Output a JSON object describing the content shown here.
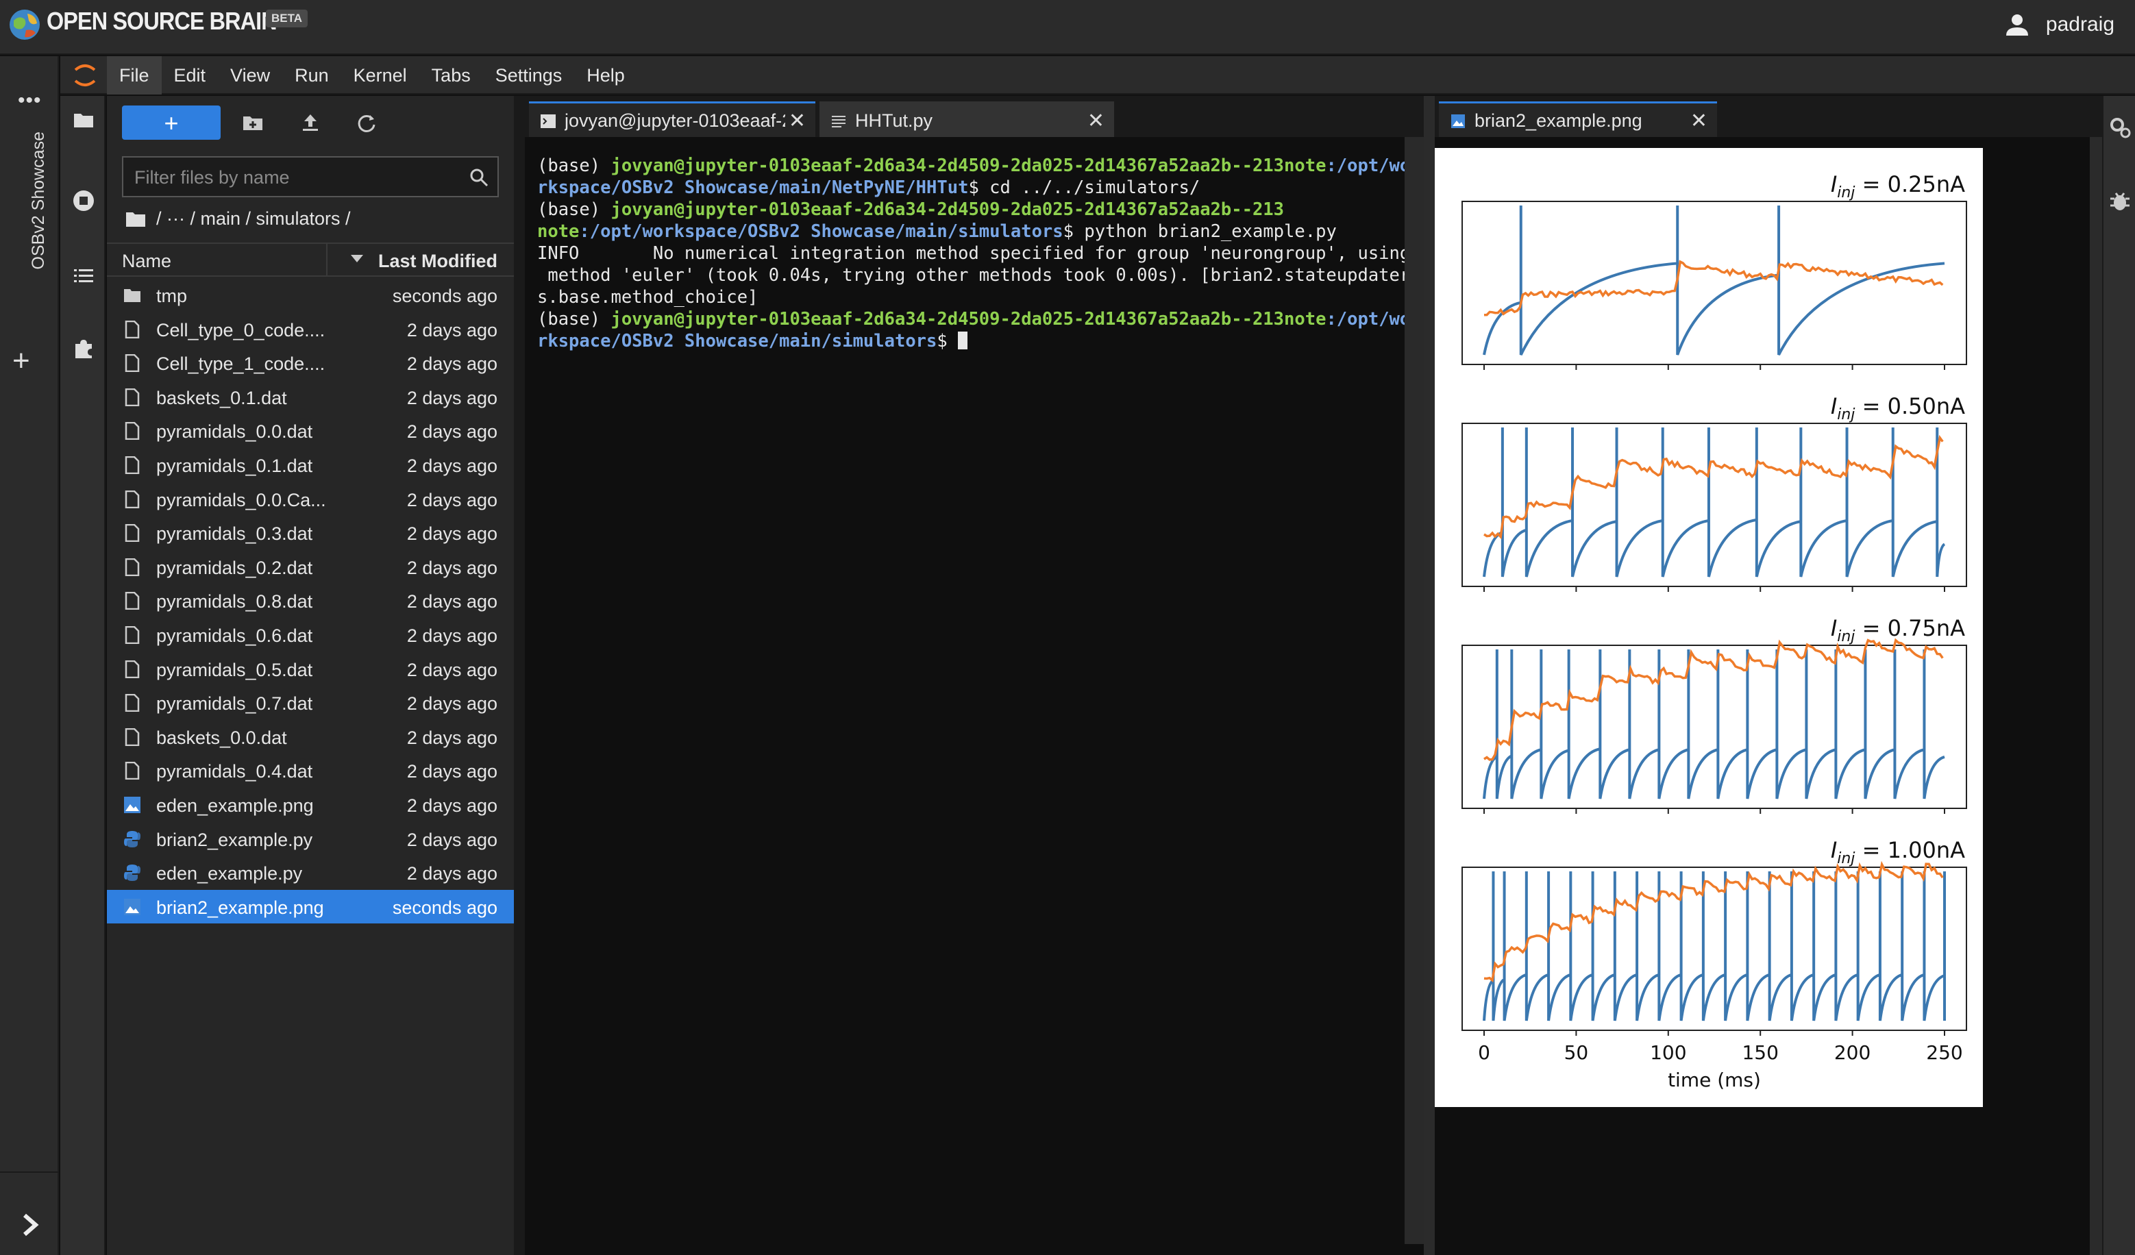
{
  "app": {
    "brand": "OPEN SOURCE BRAIN",
    "beta": "BETA",
    "user": "padraig"
  },
  "strip": {
    "dots": "•••",
    "label": "OSBv2 Showcase",
    "plus": "+"
  },
  "menu": [
    "File",
    "Edit",
    "View",
    "Run",
    "Kernel",
    "Tabs",
    "Settings",
    "Help"
  ],
  "filebrowser": {
    "new_label": "+",
    "search_placeholder": "Filter files by name",
    "breadcrumb": "/   ···  / main / simulators /",
    "col_name": "Name",
    "col_modified": "Last Modified",
    "files": [
      {
        "name": "tmp",
        "modified": "seconds ago",
        "type": "folder"
      },
      {
        "name": "Cell_type_0_code....",
        "modified": "2 days ago",
        "type": "file"
      },
      {
        "name": "Cell_type_1_code....",
        "modified": "2 days ago",
        "type": "file"
      },
      {
        "name": "baskets_0.1.dat",
        "modified": "2 days ago",
        "type": "file"
      },
      {
        "name": "pyramidals_0.0.dat",
        "modified": "2 days ago",
        "type": "file"
      },
      {
        "name": "pyramidals_0.1.dat",
        "modified": "2 days ago",
        "type": "file"
      },
      {
        "name": "pyramidals_0.0.Ca...",
        "modified": "2 days ago",
        "type": "file"
      },
      {
        "name": "pyramidals_0.3.dat",
        "modified": "2 days ago",
        "type": "file"
      },
      {
        "name": "pyramidals_0.2.dat",
        "modified": "2 days ago",
        "type": "file"
      },
      {
        "name": "pyramidals_0.8.dat",
        "modified": "2 days ago",
        "type": "file"
      },
      {
        "name": "pyramidals_0.6.dat",
        "modified": "2 days ago",
        "type": "file"
      },
      {
        "name": "pyramidals_0.5.dat",
        "modified": "2 days ago",
        "type": "file"
      },
      {
        "name": "pyramidals_0.7.dat",
        "modified": "2 days ago",
        "type": "file"
      },
      {
        "name": "baskets_0.0.dat",
        "modified": "2 days ago",
        "type": "file"
      },
      {
        "name": "pyramidals_0.4.dat",
        "modified": "2 days ago",
        "type": "file"
      },
      {
        "name": "eden_example.png",
        "modified": "2 days ago",
        "type": "image"
      },
      {
        "name": "brian2_example.py",
        "modified": "2 days ago",
        "type": "python"
      },
      {
        "name": "eden_example.py",
        "modified": "2 days ago",
        "type": "python"
      },
      {
        "name": "brian2_example.png",
        "modified": "seconds ago",
        "type": "image",
        "selected": true
      }
    ]
  },
  "tabs": {
    "terminal": "jovyan@jupyter-0103eaaf-2",
    "hhtut": "HHTut.py",
    "image": "brian2_example.png",
    "close": "✕"
  },
  "terminal": {
    "l1a": "(base) ",
    "l1b": "jovyan@jupyter-0103eaaf-2d6a34-2d4509-2da025-2d14367a52aa2b--213note",
    "l1c": ":/opt/wo",
    "l2a": "rkspace/OSBv2 Showcase/main/NetPyNE/HHTut",
    "l2b": "$ cd ../../simulators/",
    "l3a": "(base) ",
    "l3b": "jovyan@jupyter-0103eaaf-2d6a34-2d4509-2da025-2d14367a52aa2b--213",
    "l4a": "note",
    "l4b": ":/opt/workspace/OSBv2 Showcase/main/simulators",
    "l4c": "$ python brian2_example.py",
    "l5": "INFO       No numerical integration method specified for group 'neurongroup', using",
    "l6": " method 'euler' (took 0.04s, trying other methods took 0.00s). [brian2.stateupdater",
    "l7": "s.base.method_choice]",
    "l8a": "(base) ",
    "l8b": "jovyan@jupyter-0103eaaf-2d6a34-2d4509-2da025-2d14367a52aa2b--213note",
    "l8c": ":/opt/wo",
    "l9a": "rkspace/OSBv2 Showcase/main/simulators",
    "l9b": "$ "
  },
  "plot": {
    "panels": [
      {
        "title": "0.25nA",
        "spikes": [
          20,
          105,
          160
        ]
      },
      {
        "title": "0.50nA",
        "spikes": [
          10,
          23,
          48,
          72,
          97,
          122,
          148,
          172,
          197,
          222,
          246
        ]
      },
      {
        "title": "0.75nA",
        "spikes": [
          7,
          15,
          31,
          46,
          63,
          79,
          95,
          111,
          127,
          143,
          159,
          175,
          191,
          207,
          223,
          239
        ]
      },
      {
        "title": "1.00nA",
        "spikes": [
          5,
          11,
          23,
          35,
          47,
          59,
          71,
          83,
          95,
          107,
          119,
          131,
          143,
          155,
          167,
          179,
          191,
          203,
          215,
          227,
          239,
          250
        ]
      }
    ],
    "iinj_label": "I",
    "iinj_sub": "inj",
    "xticks": [
      "0",
      "50",
      "100",
      "150",
      "200",
      "250"
    ],
    "xlabel": "time (ms)",
    "colors": {
      "v": "#3b78b0",
      "other": "#ef7c2a"
    }
  }
}
